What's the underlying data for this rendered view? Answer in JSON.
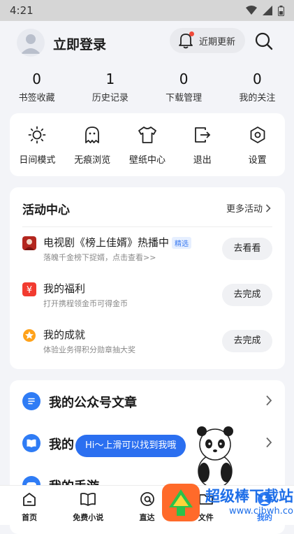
{
  "status_bar": {
    "time": "4:21"
  },
  "header": {
    "login_label": "立即登录",
    "updates_label": "近期更新"
  },
  "stats": [
    {
      "value": "0",
      "label": "书签收藏"
    },
    {
      "value": "1",
      "label": "历史记录"
    },
    {
      "value": "0",
      "label": "下载管理"
    },
    {
      "value": "0",
      "label": "我的关注"
    }
  ],
  "tools": [
    {
      "label": "日间模式",
      "icon": "sun-icon"
    },
    {
      "label": "无痕浏览",
      "icon": "ghost-icon"
    },
    {
      "label": "壁纸中心",
      "icon": "shirt-icon"
    },
    {
      "label": "退出",
      "icon": "exit-icon"
    },
    {
      "label": "设置",
      "icon": "settings-icon"
    }
  ],
  "activity": {
    "title": "活动中心",
    "more": "更多活动",
    "items": [
      {
        "title": "电视剧《榜上佳婿》热播中",
        "badge": "精选",
        "subtitle": "落魄千金榜下捉婿，点击查看>>",
        "button": "去看看"
      },
      {
        "title": "我的福利",
        "subtitle": "打开携程领金币可得金币",
        "button": "去完成"
      },
      {
        "title": "我的成就",
        "subtitle": "体验业务得积分勋章抽大奖",
        "button": "去完成"
      }
    ]
  },
  "articles": [
    {
      "label": "我的公众号文章"
    },
    {
      "label": "我的"
    },
    {
      "label": "我的手游"
    }
  ],
  "tooltip": "Hi～上滑可以找到我哦",
  "tabbar": [
    {
      "label": "首页"
    },
    {
      "label": "免费小说"
    },
    {
      "label": "直达"
    },
    {
      "label": "文件"
    },
    {
      "label": "我的"
    }
  ],
  "watermark": {
    "text": "超级棒下载站",
    "url": "www.cjbwh.com"
  },
  "colors": {
    "accent": "#2f7cf5",
    "badge_red": "#f04a3a",
    "background": "#f3f4f8"
  }
}
